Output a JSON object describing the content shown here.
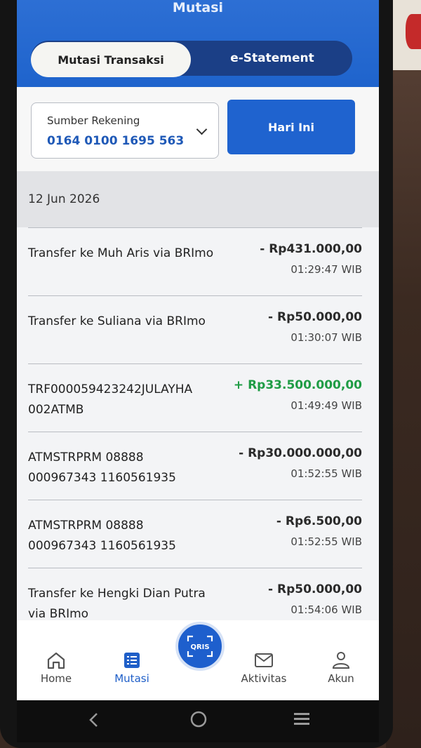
{
  "header": {
    "title": "Mutasi",
    "tabs": [
      {
        "label": "Mutasi Transaksi",
        "active": true
      },
      {
        "label": "e-Statement",
        "active": false
      }
    ]
  },
  "filters": {
    "source_label": "Sumber Rekening",
    "source_value": "0164 0100 1695 563",
    "range_button": "Hari Ini"
  },
  "date_group": "12 Jun 2026",
  "transactions": [
    {
      "desc": "Transfer ke Muh Aris via BRImo",
      "amount": "- Rp431.000,00",
      "time": "01:29:47 WIB",
      "type": "debit"
    },
    {
      "desc": "Transfer ke Suliana via BRImo",
      "amount": "- Rp50.000,00",
      "time": "01:30:07 WIB",
      "type": "debit"
    },
    {
      "desc": "TRF000059423242JULAYHA 002ATMB",
      "amount": "+ Rp33.500.000,00",
      "time": "01:49:49 WIB",
      "type": "credit"
    },
    {
      "desc": "ATMSTRPRM 08888 000967343 1160561935",
      "amount": "- Rp30.000.000,00",
      "time": "01:52:55 WIB",
      "type": "debit"
    },
    {
      "desc": "ATMSTRPRM 08888 000967343 1160561935",
      "amount": "- Rp6.500,00",
      "time": "01:52:55 WIB",
      "type": "debit"
    },
    {
      "desc": "Transfer ke Hengki Dian Putra via BRImo",
      "amount": "- Rp50.000,00",
      "time": "01:54:06 WIB",
      "type": "debit"
    }
  ],
  "nav": {
    "items": [
      {
        "label": "Home",
        "icon": "home-icon"
      },
      {
        "label": "Mutasi",
        "icon": "mutasi-icon",
        "active": true
      },
      {
        "label": "QRIS",
        "icon": "qris-icon"
      },
      {
        "label": "Aktivitas",
        "icon": "mail-icon"
      },
      {
        "label": "Akun",
        "icon": "user-icon"
      }
    ]
  },
  "colors": {
    "primary": "#1f63cf",
    "credit": "#1f9c45",
    "debit": "#2b2b2b"
  }
}
